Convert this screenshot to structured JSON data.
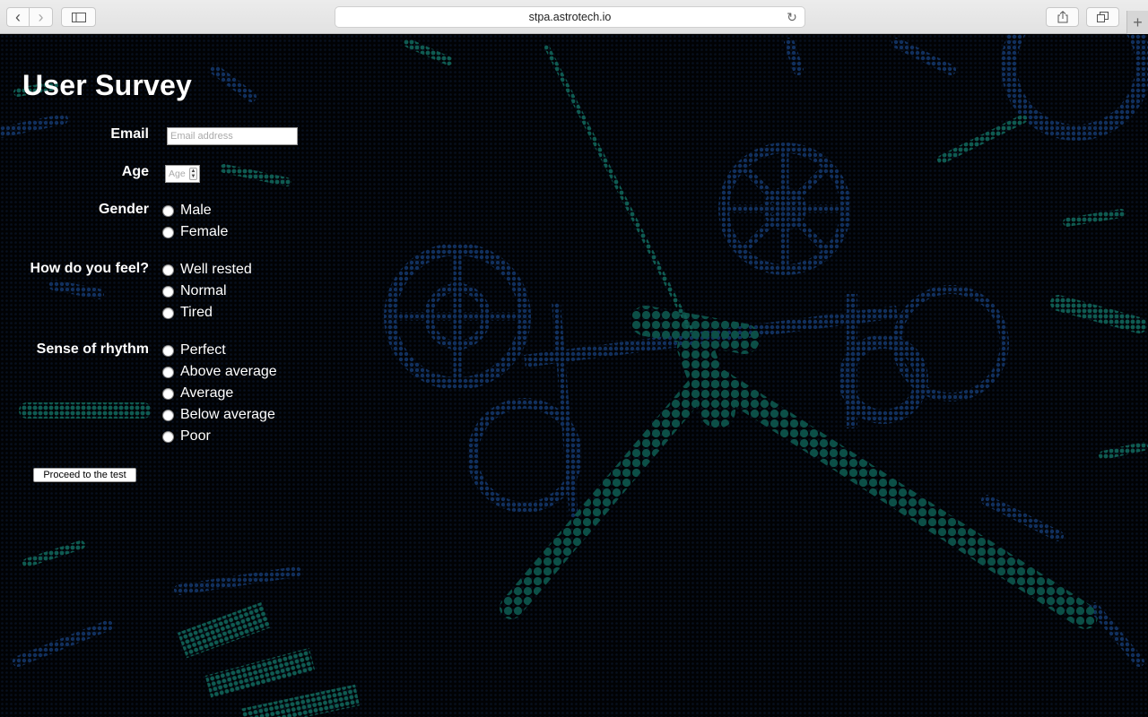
{
  "browser": {
    "url": "stpa.astrotech.io",
    "back_icon": "‹",
    "forward_icon": "›",
    "sidebar_icon": "▯",
    "reload_icon": "↻",
    "share_icon": "⇧",
    "tabs_icon": "❐",
    "newtab_icon": "+"
  },
  "page": {
    "title": "User Survey",
    "email": {
      "label": "Email",
      "placeholder": "Email address",
      "value": ""
    },
    "age": {
      "label": "Age",
      "placeholder": "Age",
      "value": ""
    },
    "gender": {
      "label": "Gender",
      "options": [
        "Male",
        "Female"
      ]
    },
    "feel": {
      "label": "How do you feel?",
      "options": [
        "Well rested",
        "Normal",
        "Tired"
      ]
    },
    "rhythm": {
      "label": "Sense of rhythm",
      "options": [
        "Perfect",
        "Above average",
        "Average",
        "Below average",
        "Poor"
      ]
    },
    "proceed_label": "Proceed to the test"
  },
  "colors": {
    "background": "#020306",
    "gear_blue": "#0d2a55",
    "accent_teal": "#0f5a52",
    "text": "#ffffff"
  }
}
